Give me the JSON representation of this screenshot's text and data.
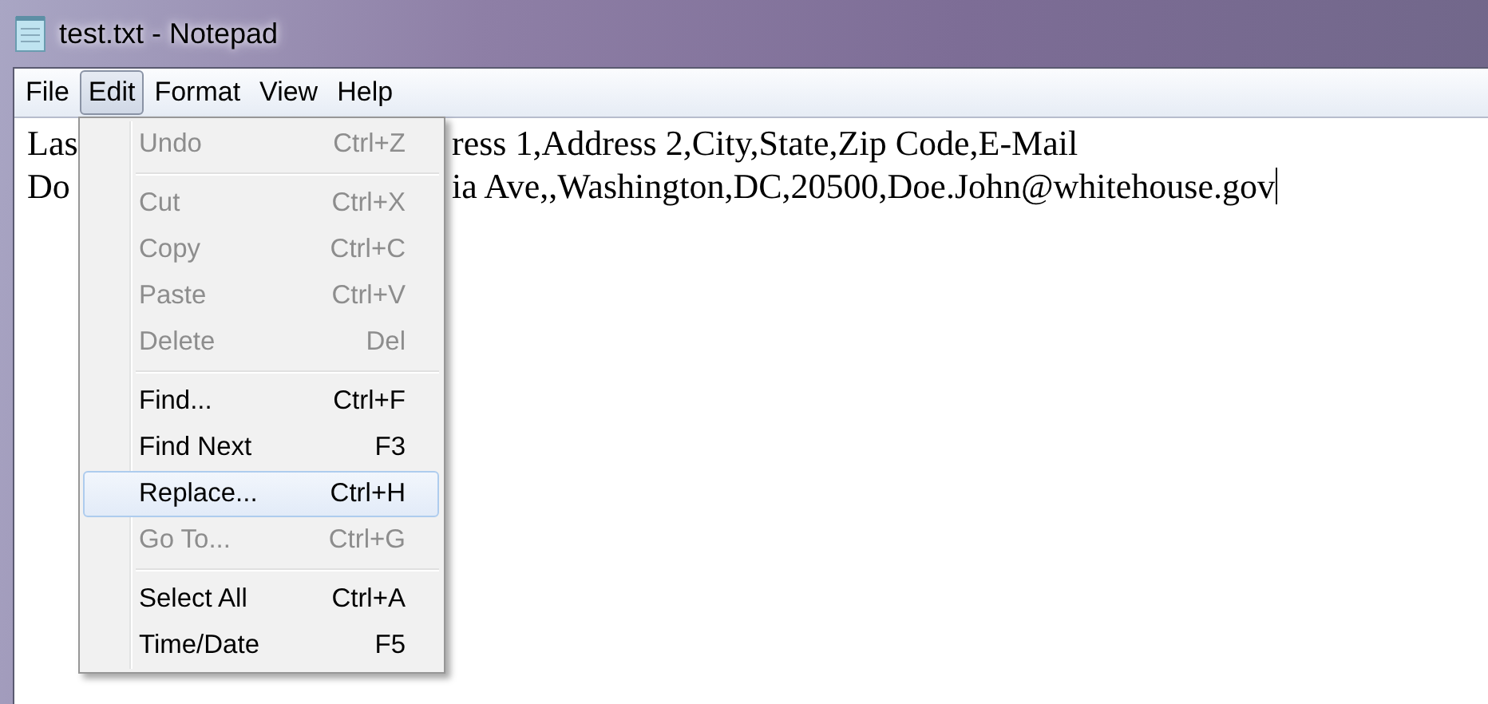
{
  "window": {
    "title": "test.txt - Notepad"
  },
  "menubar": [
    {
      "label": "File",
      "selected": false
    },
    {
      "label": "Edit",
      "selected": true
    },
    {
      "label": "Format",
      "selected": false
    },
    {
      "label": "View",
      "selected": false
    },
    {
      "label": "Help",
      "selected": false
    }
  ],
  "editor": {
    "lines": [
      {
        "start": "Las",
        "end": "ress 1,Address 2,City,State,Zip Code,E-Mail"
      },
      {
        "start": "Do",
        "end": "ia Ave,,Washington,DC,20500,Doe.John@whitehouse.gov"
      }
    ]
  },
  "edit_menu": [
    {
      "kind": "item",
      "label": "Undo",
      "shortcut": "Ctrl+Z",
      "disabled": true,
      "selected": false
    },
    {
      "kind": "separator"
    },
    {
      "kind": "item",
      "label": "Cut",
      "shortcut": "Ctrl+X",
      "disabled": true,
      "selected": false
    },
    {
      "kind": "item",
      "label": "Copy",
      "shortcut": "Ctrl+C",
      "disabled": true,
      "selected": false
    },
    {
      "kind": "item",
      "label": "Paste",
      "shortcut": "Ctrl+V",
      "disabled": true,
      "selected": false
    },
    {
      "kind": "item",
      "label": "Delete",
      "shortcut": "Del",
      "disabled": true,
      "selected": false
    },
    {
      "kind": "separator"
    },
    {
      "kind": "item",
      "label": "Find...",
      "shortcut": "Ctrl+F",
      "disabled": false,
      "selected": false
    },
    {
      "kind": "item",
      "label": "Find Next",
      "shortcut": "F3",
      "disabled": false,
      "selected": false
    },
    {
      "kind": "item",
      "label": "Replace...",
      "shortcut": "Ctrl+H",
      "disabled": false,
      "selected": true
    },
    {
      "kind": "item",
      "label": "Go To...",
      "shortcut": "Ctrl+G",
      "disabled": true,
      "selected": false
    },
    {
      "kind": "separator"
    },
    {
      "kind": "item",
      "label": "Select All",
      "shortcut": "Ctrl+A",
      "disabled": false,
      "selected": false
    },
    {
      "kind": "item",
      "label": "Time/Date",
      "shortcut": "F5",
      "disabled": false,
      "selected": false
    }
  ]
}
